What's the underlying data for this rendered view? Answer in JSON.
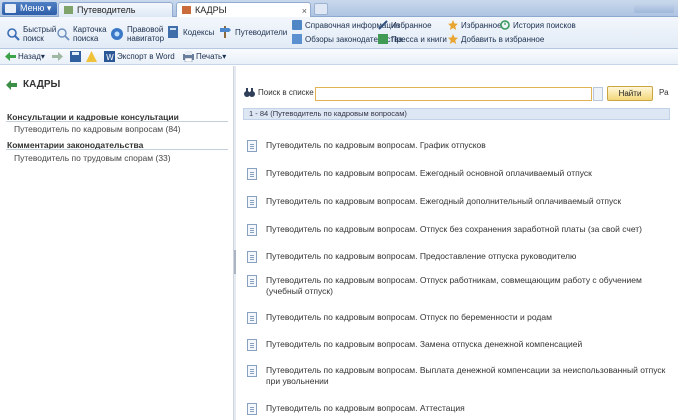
{
  "tabbar": {
    "menu_label": "Меню",
    "tab1_label": "Путеводитель",
    "tab2_label": "КАДРЫ",
    "tab_close": "×"
  },
  "ribbon": {
    "items": [
      {
        "label": "Быстрый поиск"
      },
      {
        "label": "Карточка поиска"
      },
      {
        "label": "Правовой навигатор"
      },
      {
        "label": "Кодексы"
      },
      {
        "label": "Путеводители"
      }
    ],
    "small_items": [
      {
        "label": "Справочная информация"
      },
      {
        "label": "Обзоры законодательства"
      },
      {
        "label": "Избранное"
      },
      {
        "label": "Пресса и книги"
      },
      {
        "label": "Избранное"
      },
      {
        "label": "История поисков"
      },
      {
        "label": "Добавить в избранное"
      }
    ]
  },
  "toolbar": {
    "back_label": "Назад",
    "export_label": "Экспорт в Word",
    "print_label": "Печать"
  },
  "left": {
    "title": "КАДРЫ",
    "sections": [
      {
        "title": "Консультации и кадровые консультации",
        "item": "Путеводитель по кадровым вопросам (84)"
      },
      {
        "title": "Комментарии законодательства",
        "item": "Путеводитель по трудовым спорам (33)"
      }
    ]
  },
  "right": {
    "search_label": "Поиск в списке",
    "search_placeholder": "",
    "search_button": "Найти",
    "search_more": "Ра",
    "results_label": "1 - 84 (Путеводитель по кадровым вопросам)",
    "documents": [
      {
        "title": "Путеводитель по кадровым вопросам. График отпусков"
      },
      {
        "title": "Путеводитель по кадровым вопросам. Ежегодный основной оплачиваемый отпуск"
      },
      {
        "title": "Путеводитель по кадровым вопросам. Ежегодный дополнительный оплачиваемый отпуск"
      },
      {
        "title": "Путеводитель по кадровым вопросам. Отпуск без сохранения заработной платы (за свой счет)"
      },
      {
        "title": "Путеводитель по кадровым вопросам. Предоставление отпуска руководителю"
      },
      {
        "title": "Путеводитель по кадровым вопросам. Отпуск работникам, совмещающим работу с обучением (учебный отпуск)"
      },
      {
        "title": "Путеводитель по кадровым вопросам. Отпуск по беременности и родам"
      },
      {
        "title": "Путеводитель по кадровым вопросам. Замена отпуска денежной компенсацией"
      },
      {
        "title": "Путеводитель по кадровым вопросам. Выплата денежной компенсации за неиспользованный отпуск при увольнении"
      },
      {
        "title": "Путеводитель по кадровым вопросам. Аттестация"
      }
    ]
  },
  "colors": {
    "accent": "#2e5ea8",
    "search_border": "#e0b350",
    "results_bg": "#dde7f4"
  }
}
